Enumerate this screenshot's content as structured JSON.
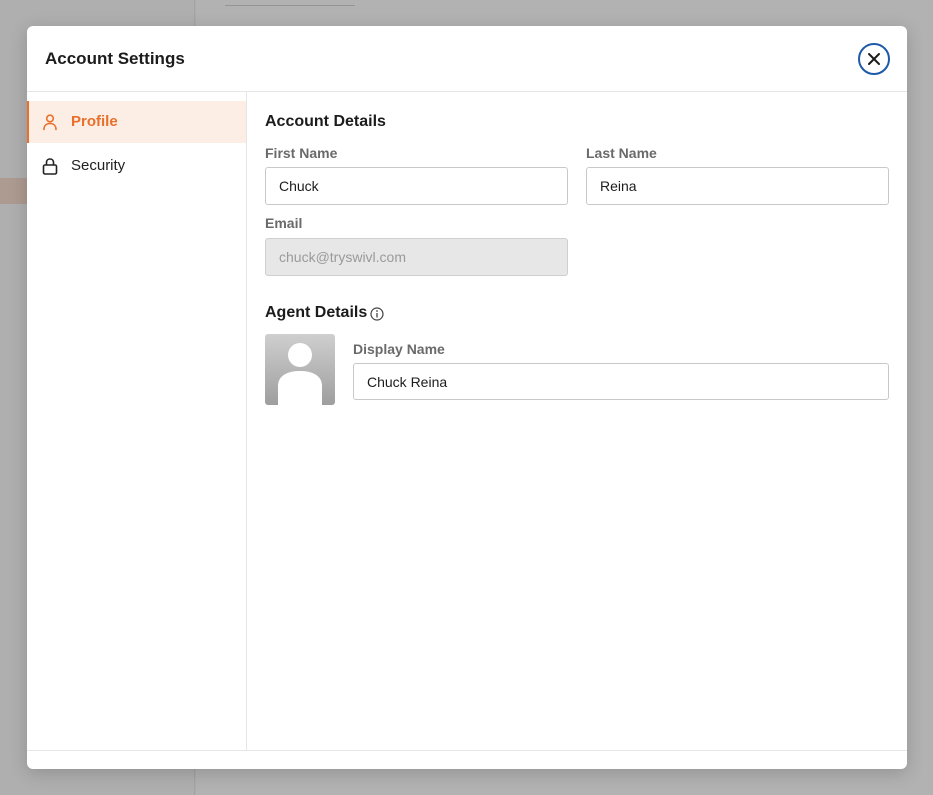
{
  "modal": {
    "title": "Account Settings",
    "close_icon": "close-icon"
  },
  "sidebar": {
    "items": [
      {
        "label": "Profile",
        "icon": "user-icon",
        "active": true
      },
      {
        "label": "Security",
        "icon": "lock-icon",
        "active": false
      }
    ]
  },
  "account_details": {
    "title": "Account Details",
    "first_name": {
      "label": "First Name",
      "value": "Chuck"
    },
    "last_name": {
      "label": "Last Name",
      "value": "Reina"
    },
    "email": {
      "label": "Email",
      "value": "chuck@tryswivl.com",
      "disabled": true
    }
  },
  "agent_details": {
    "title": "Agent Details",
    "info_icon": "info-icon",
    "avatar_icon": "avatar-placeholder-icon",
    "display_name": {
      "label": "Display Name",
      "value": "Chuck Reina"
    }
  },
  "colors": {
    "accent": "#e8702a",
    "active_bg": "#fdeee5",
    "close_border": "#1e5aa8"
  }
}
